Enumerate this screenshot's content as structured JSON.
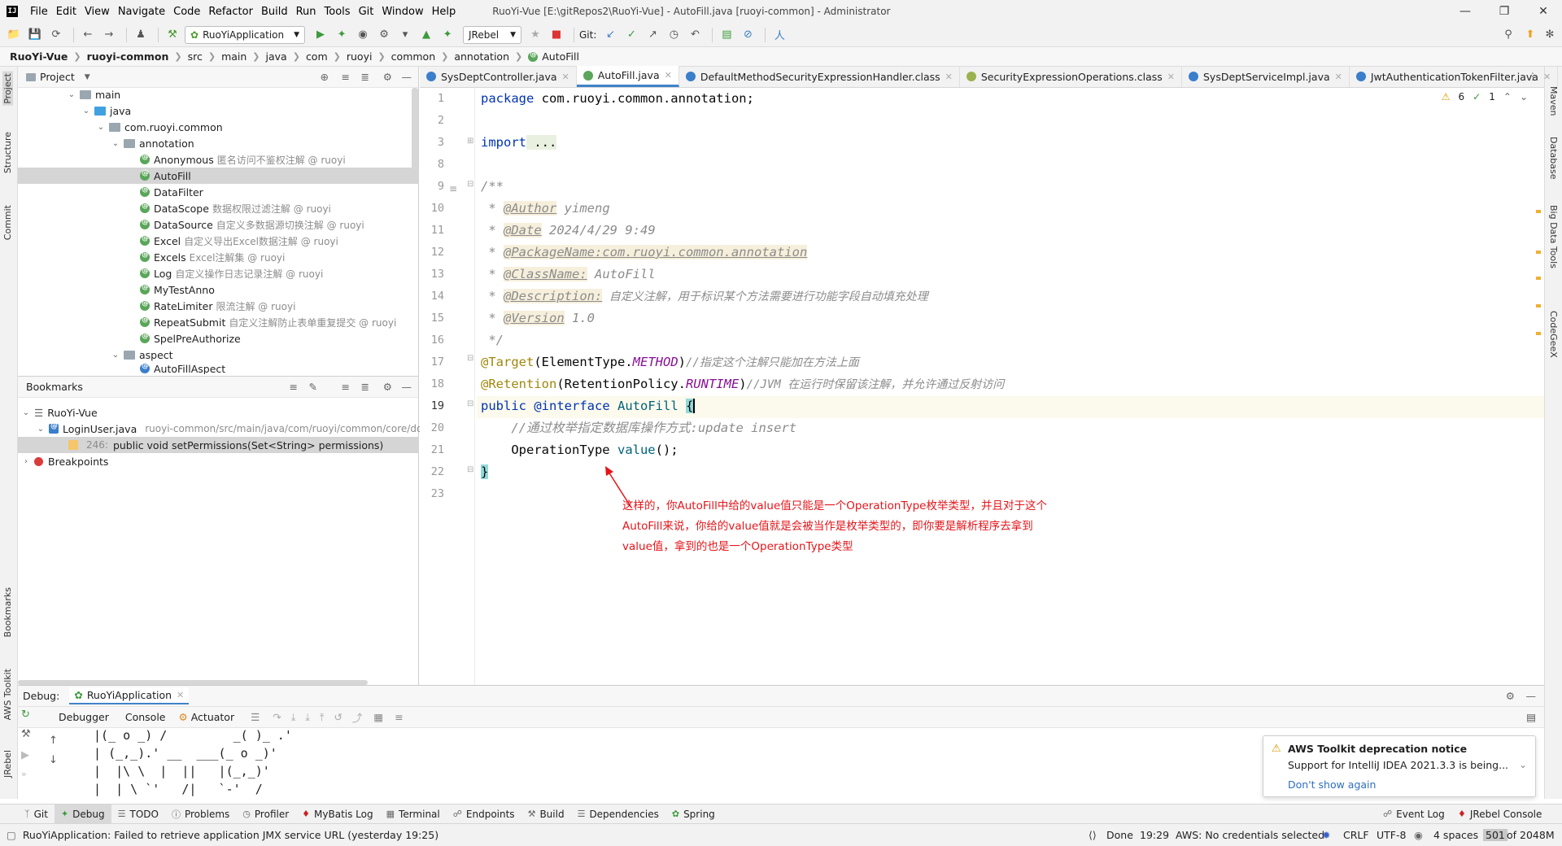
{
  "window": {
    "title": "RuoYi-Vue [E:\\gitRepos2\\RuoYi-Vue] - AutoFill.java [ruoyi-common] - Administrator",
    "menu": [
      "File",
      "Edit",
      "View",
      "Navigate",
      "Code",
      "Refactor",
      "Build",
      "Run",
      "Tools",
      "Git",
      "Window",
      "Help"
    ]
  },
  "toolbar": {
    "run_config": "RuoYiApplication",
    "jrebel": "JRebel",
    "git_label": "Git:"
  },
  "breadcrumb": [
    "RuoYi-Vue",
    "ruoyi-common",
    "src",
    "main",
    "java",
    "com",
    "ruoyi",
    "common",
    "annotation",
    "AutoFill"
  ],
  "left_strip": [
    "Project",
    "Structure",
    "Commit",
    "Bookmarks",
    "AWS Toolkit",
    "JRebel"
  ],
  "right_strip": [
    "Maven",
    "Database",
    "Big Data Tools",
    "CodeGeeX"
  ],
  "project": {
    "title": "Project",
    "tree": [
      {
        "label": "main",
        "hint": ""
      },
      {
        "label": "java",
        "hint": ""
      },
      {
        "label": "com.ruoyi.common",
        "hint": ""
      },
      {
        "label": "annotation",
        "hint": ""
      },
      {
        "label": "Anonymous",
        "hint": "匿名访问不鉴权注解 @ ruoyi"
      },
      {
        "label": "AutoFill",
        "hint": ""
      },
      {
        "label": "DataFilter",
        "hint": ""
      },
      {
        "label": "DataScope",
        "hint": "数据权限过滤注解 @ ruoyi"
      },
      {
        "label": "DataSource",
        "hint": "自定义多数据源切换注解 @ ruoyi"
      },
      {
        "label": "Excel",
        "hint": "自定义导出Excel数据注解 @ ruoyi"
      },
      {
        "label": "Excels",
        "hint": "Excel注解集 @ ruoyi"
      },
      {
        "label": "Log",
        "hint": "自定义操作日志记录注解 @ ruoyi"
      },
      {
        "label": "MyTestAnno",
        "hint": ""
      },
      {
        "label": "RateLimiter",
        "hint": "限流注解 @ ruoyi"
      },
      {
        "label": "RepeatSubmit",
        "hint": "自定义注解防止表单重复提交 @ ruoyi"
      },
      {
        "label": "SpelPreAuthorize",
        "hint": ""
      },
      {
        "label": "aspect",
        "hint": ""
      },
      {
        "label": "AutoFillAspect",
        "hint": ""
      }
    ]
  },
  "bookmarks": {
    "title": "Bookmarks",
    "root": "RuoYi-Vue",
    "file": "LoginUser.java",
    "file_path": "ruoyi-common/src/main/java/com/ruoyi/common/core/do",
    "line_no": "246:",
    "line_text": "public void setPermissions(Set<String> permissions)",
    "breakpoints": "Breakpoints"
  },
  "editor": {
    "tabs": [
      "SysDeptController.java",
      "AutoFill.java",
      "DefaultMethodSecurityExpressionHandler.class",
      "SecurityExpressionOperations.class",
      "SysDeptServiceImpl.java",
      "JwtAuthenticationTokenFilter.java"
    ],
    "warnings": "6",
    "checks": "1",
    "line_numbers": [
      "1",
      "2",
      "3",
      "8",
      "9",
      "10",
      "11",
      "12",
      "13",
      "14",
      "15",
      "16",
      "17",
      "18",
      "19",
      "20",
      "21",
      "22",
      "23"
    ],
    "code": {
      "l1_kw": "package",
      "l1_rest": " com.ruoyi.common.annotation;",
      "l3_kw": "import",
      "l3_rest": " ...",
      "l9": "/**",
      "l10_pre": " * ",
      "l10_tag": "@Author",
      "l10_val": " yimeng",
      "l11_tag": "@Date",
      "l11_val": " 2024/4/29 9:49",
      "l12_tag": "@PackageName:com.ruoyi.common.annotation",
      "l13_tag": "@ClassName:",
      "l13_val": " AutoFill",
      "l14_tag": "@Description:",
      "l14_val": " 自定义注解，用于标识某个方法需要进行功能字段自动填充处理",
      "l15_tag": "@Version",
      "l15_val": " 1.0",
      "l16": " */",
      "l17_ann": "@Target",
      "l17_a": "(ElementType.",
      "l17_en": "METHOD",
      "l17_b": ")",
      "l17_cm": "//指定这个注解只能加在方法上面",
      "l18_ann": "@Retention",
      "l18_a": "(RetentionPolicy.",
      "l18_en": "RUNTIME",
      "l18_b": ")",
      "l18_cm": "//JVM 在运行时保留该注解，并允许通过反射访问",
      "l19_kw": "public",
      "l19_kw2": "@interface",
      "l19_name": "AutoFill",
      "l19_brace": "{",
      "l20_cm": "    //通过枚举指定数据库操作方式:update insert",
      "l21_type": "    OperationType ",
      "l21_fn": "value",
      "l21_rest": "();",
      "l22": "}"
    },
    "note_lines": [
      "这样的，你AutoFill中给的value值只能是一个OperationType枚举类型，并且对于这个",
      "AutoFill来说，你给的value值就是会被当作是枚举类型的，即你要是解析程序去拿到",
      "value值，拿到的也是一个OperationType类型"
    ]
  },
  "debug": {
    "label": "Debug:",
    "session": "RuoYiApplication",
    "tabs": [
      "Debugger",
      "Console",
      "Actuator"
    ],
    "console": [
      " |(_ o _) /         _( )_ .'",
      " | (_,_).' __  ___(_ o _)'",
      " |  |\\ \\  |  ||   |(_,_)'",
      " |  | \\ `'   /|   `-'  /"
    ]
  },
  "aws_notice": {
    "title": "AWS Toolkit deprecation notice",
    "body": "Support for IntelliJ IDEA 2021.3.3 is being...",
    "action": "Don't show again"
  },
  "tool_windows": [
    "Git",
    "Debug",
    "TODO",
    "Problems",
    "Profiler",
    "MyBatis Log",
    "Terminal",
    "Endpoints",
    "Build",
    "Dependencies",
    "Spring"
  ],
  "tool_windows_right": [
    "Event Log",
    "JRebel Console"
  ],
  "status": {
    "message": "RuoYiApplication: Failed to retrieve application JMX service URL (yesterday 19:25)",
    "done": "Done",
    "time": "19:29",
    "aws": "AWS: No credentials selected",
    "crlf": "CRLF",
    "encoding": "UTF-8",
    "indent": "4 spaces",
    "mem_used": "501",
    "mem_total": "of 2048M"
  }
}
